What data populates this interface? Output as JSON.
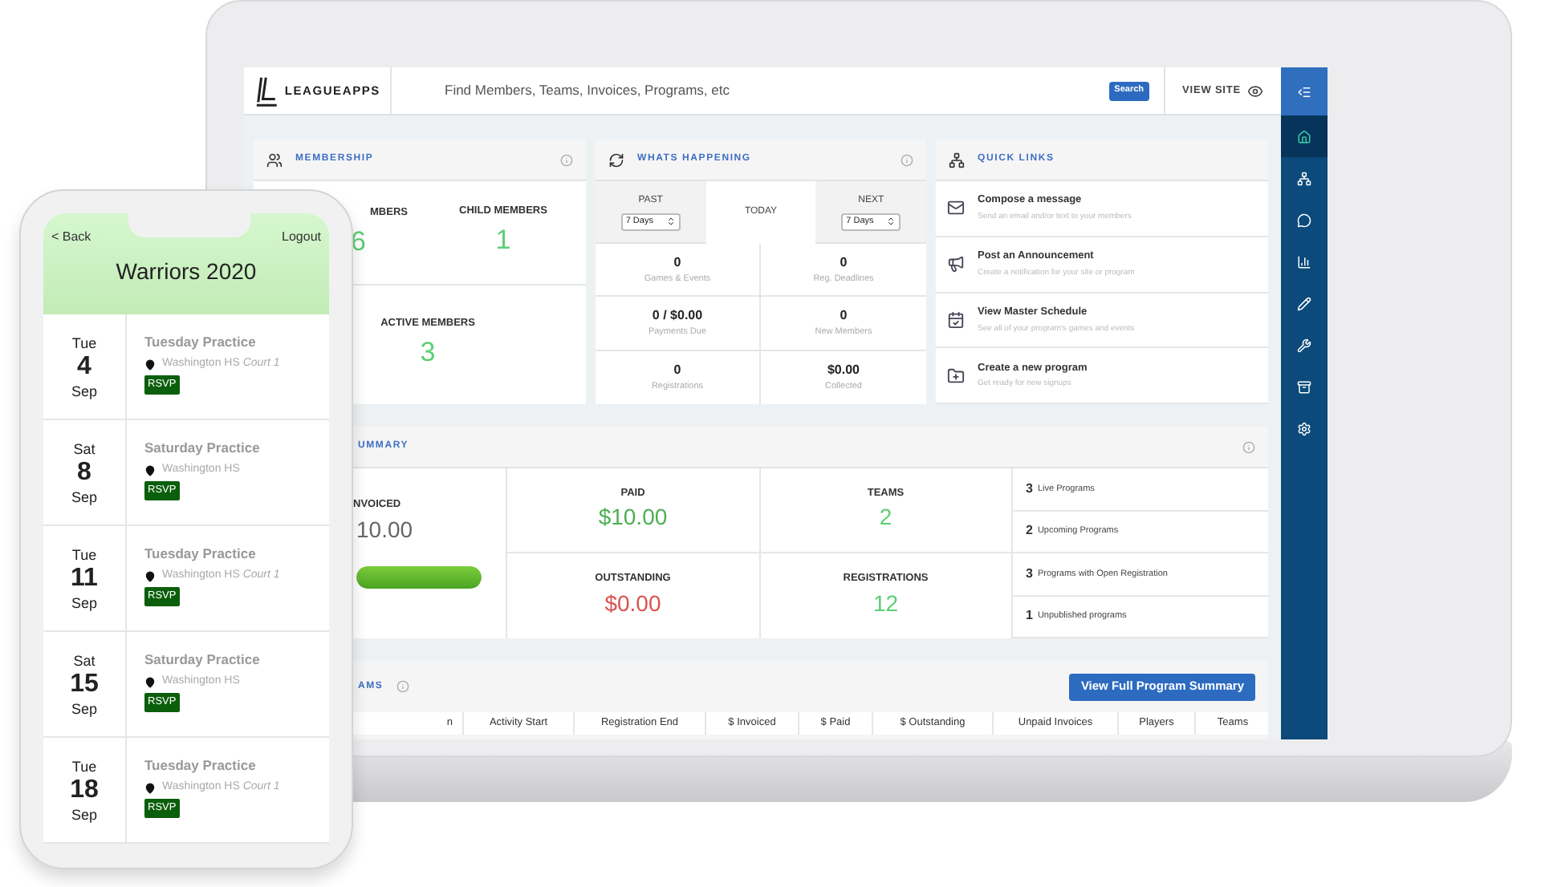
{
  "topbar": {
    "logo": "LEAGUEAPPS",
    "search_placeholder": "Find Members, Teams, Invoices, Programs, etc",
    "search_button": "Search",
    "view_site": "VIEW SITE"
  },
  "sidebar": {
    "items": [
      {
        "kind": "collapse",
        "selected": false
      },
      {
        "kind": "home",
        "selected": true
      },
      {
        "kind": "sitemap",
        "selected": false
      },
      {
        "kind": "chat",
        "selected": false
      },
      {
        "kind": "chart",
        "selected": false
      },
      {
        "kind": "edit",
        "selected": false
      },
      {
        "kind": "tools",
        "selected": false
      },
      {
        "kind": "archive",
        "selected": false
      },
      {
        "kind": "settings",
        "selected": false
      }
    ]
  },
  "membership": {
    "title": "MEMBERSHIP",
    "stats": [
      {
        "label": "MBERS",
        "value": "6"
      },
      {
        "label": "CHILD MEMBERS",
        "value": "1"
      },
      {
        "label": "ACTIVE MEMBERS",
        "value": "3"
      }
    ]
  },
  "whats_happening": {
    "title": "WHATS HAPPENING",
    "tabs": [
      {
        "label": "PAST",
        "select": "7 Days",
        "selected": false
      },
      {
        "label": "TODAY",
        "selected": true
      },
      {
        "label": "NEXT",
        "select": "7 Days",
        "selected": false
      }
    ],
    "stats": [
      {
        "value": "0",
        "label": "Games & Events"
      },
      {
        "value": "0",
        "label": "Reg. Deadlines"
      },
      {
        "value": "0 / $0.00",
        "label": "Payments Due"
      },
      {
        "value": "0",
        "label": "New Members"
      },
      {
        "value": "0",
        "label": "Registrations"
      },
      {
        "value": "$0.00",
        "label": "Collected"
      }
    ]
  },
  "quick_links": {
    "title": "QUICK LINKS",
    "items": [
      {
        "kind": "message",
        "title": "Compose a message",
        "subtitle": "Send an email and/or text to your members"
      },
      {
        "kind": "announcement",
        "title": "Post an Announcement",
        "subtitle": "Create a notification for your site or program"
      },
      {
        "kind": "schedule",
        "title": "View Master Schedule",
        "subtitle": "See all of your program's games and events"
      },
      {
        "kind": "program",
        "title": "Create a new program",
        "subtitle": "Get ready for new signups"
      }
    ]
  },
  "financial_summary": {
    "title": "UMMARY",
    "invoiced": {
      "label": "NVOICED",
      "value": "10.00",
      "level": 1
    },
    "stats": [
      {
        "label": "PAID",
        "value": "$10.00",
        "kind": "money"
      },
      {
        "label": "TEAMS",
        "value": "2",
        "kind": "count"
      },
      {
        "label": "OUTSTANDING",
        "value": "$0.00",
        "kind": "due"
      },
      {
        "label": "REGISTRATIONS",
        "value": "12",
        "kind": "count"
      }
    ],
    "programs": [
      {
        "count": "3",
        "label": "Live Programs"
      },
      {
        "count": "2",
        "label": "Upcoming Programs"
      },
      {
        "count": "3",
        "label": "Programs with Open Registration"
      },
      {
        "count": "1",
        "label": "Unpublished programs"
      }
    ]
  },
  "programs": {
    "title": "AMS",
    "button": "View Full Program Summary",
    "columns": [
      "n",
      "Activity Start",
      "Registration End",
      "$ Invoiced",
      "$ Paid",
      "$ Outstanding",
      "Unpaid Invoices",
      "Players",
      "Teams"
    ]
  },
  "phone": {
    "back": "< Back",
    "logout": "Logout",
    "title": "Warriors 2020",
    "events": [
      {
        "weekday": "Tue",
        "day": "4",
        "month": "Sep",
        "title": "Tuesday Practice",
        "location": "Washington HS *Court 1*",
        "rsvp": "RSVP"
      },
      {
        "weekday": "Sat",
        "day": "8",
        "month": "Sep",
        "title": "Saturday Practice",
        "location": "Washington HS",
        "rsvp": "RSVP"
      },
      {
        "weekday": "Tue",
        "day": "11",
        "month": "Sep",
        "title": "Tuesday Practice",
        "location": "Washington HS *Court 1*",
        "rsvp": "RSVP"
      },
      {
        "weekday": "Sat",
        "day": "15",
        "month": "Sep",
        "title": "Saturday Practice",
        "location": "Washington HS",
        "rsvp": "RSVP"
      },
      {
        "weekday": "Tue",
        "day": "18",
        "month": "Sep",
        "title": "Tuesday Practice",
        "location": "Washington HS *Court 1*",
        "rsvp": "RSVP"
      }
    ]
  }
}
